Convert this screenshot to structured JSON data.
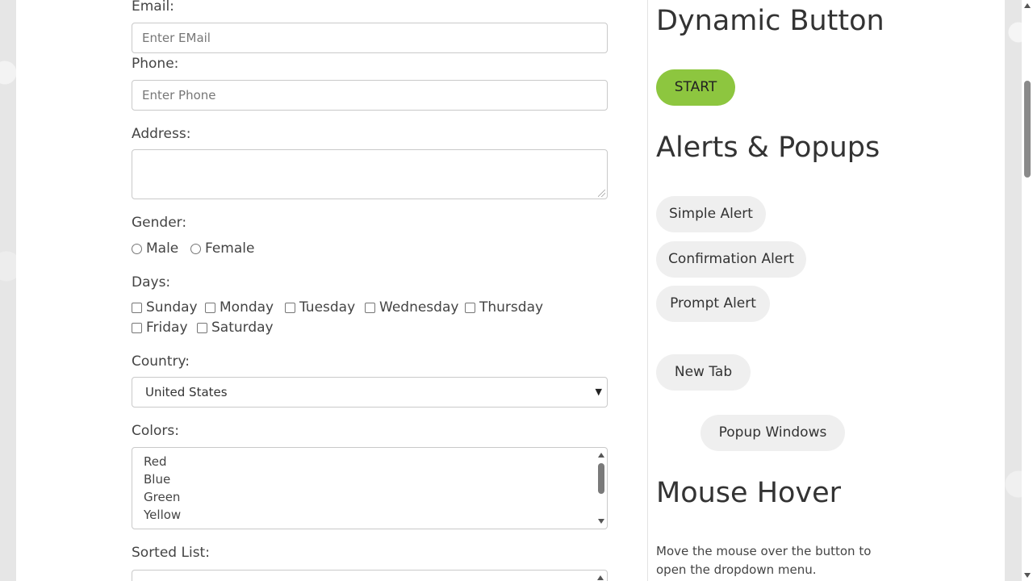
{
  "form": {
    "email": {
      "label": "Email:",
      "placeholder": "Enter EMail"
    },
    "phone": {
      "label": "Phone:",
      "placeholder": "Enter Phone"
    },
    "address": {
      "label": "Address:"
    },
    "gender": {
      "label": "Gender:",
      "options": [
        "Male",
        "Female"
      ]
    },
    "days": {
      "label": "Days:",
      "options": [
        "Sunday",
        "Monday",
        "Tuesday",
        "Wednesday",
        "Thursday",
        "Friday",
        "Saturday"
      ]
    },
    "country": {
      "label": "Country:",
      "selected": "United States"
    },
    "colors": {
      "label": "Colors:",
      "options": [
        "Red",
        "Blue",
        "Green",
        "Yellow"
      ]
    },
    "sorted_list": {
      "label": "Sorted List:"
    }
  },
  "sidebar": {
    "dynamic_button": {
      "heading": "Dynamic Button",
      "button": "START",
      "button_color": "#8dc63f"
    },
    "alerts": {
      "heading": "Alerts & Popups",
      "simple": "Simple Alert",
      "confirmation": "Confirmation Alert",
      "prompt": "Prompt Alert",
      "new_tab": "New Tab",
      "popup_windows": "Popup Windows"
    },
    "mouse_hover": {
      "heading": "Mouse Hover",
      "description": "Move the mouse over the button to open the dropdown menu."
    }
  }
}
